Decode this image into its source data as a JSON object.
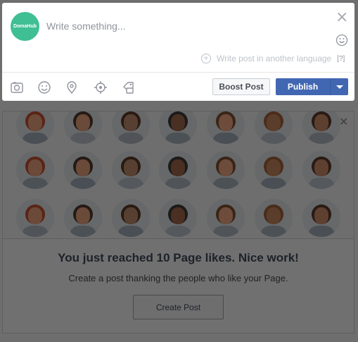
{
  "composer": {
    "avatar_text": "DomaHub",
    "placeholder": "Write something...",
    "close_icon": "close-icon",
    "language_link": "Write post in another language",
    "help_label": "[?]",
    "tools": [
      "photo-icon",
      "emoji-icon",
      "location-icon",
      "target-icon",
      "tag-icon"
    ],
    "boost_label": "Boost Post",
    "publish_label": "Publish"
  },
  "milestone": {
    "headline": "You just reached 10 Page likes. Nice work!",
    "subtext": "Create a post thanking the people who like your Page.",
    "cta_label": "Create Post"
  },
  "colors": {
    "accent": "#4267b2",
    "avatar": "#3fbf93",
    "overlay": "#6e6e6e"
  }
}
